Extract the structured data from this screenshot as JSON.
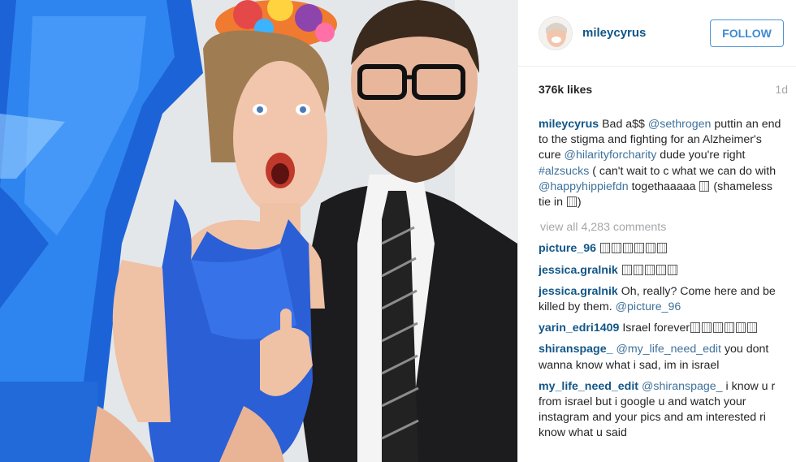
{
  "post": {
    "username": "mileycyrus",
    "follow_label": "FOLLOW",
    "likes": "376k likes",
    "time_ago": "1d"
  },
  "caption": {
    "user": "mileycyrus",
    "t1": "Bad a$$ ",
    "m1": "@sethrogen",
    "t2": " puttin an end to the stigma and fighting for an Alzheimer's cure ",
    "m2": "@hilarityforcharity",
    "t3": " dude you're right ",
    "m3": "#alzsucks",
    "t4": " ( can't wait to c what we can do with ",
    "m4": "@happyhippiefdn",
    "t5": " togethaaaaa ",
    "t6": " (shameless tie in ",
    "t7": ")"
  },
  "view_all": "view all 4,283 comments",
  "comments": [
    {
      "user": "picture_96"
    },
    {
      "user": "jessica.gralnik"
    },
    {
      "user": "jessica.gralnik",
      "text": " Oh, really? Come here and be killed by them. ",
      "mention": "@picture_96"
    },
    {
      "user": "yarin_edri1409",
      "text": " Israel forever"
    },
    {
      "user": "shiranspage_",
      "mention": "@my_life_need_edit",
      "text": " you dont wanna know what i sad, im in israel"
    },
    {
      "user": "my_life_need_edit",
      "mention": "@shiranspage_",
      "text": " i know u r from israel but i google u and watch your instagram and your pics and am interested ri know what u said"
    }
  ],
  "colors": {
    "username_blue": "#125688",
    "mention_blue": "#3f729b",
    "follow_blue": "#3f8ad1",
    "muted_gray": "#a5a7aa",
    "swimsuit_blue": "#2a5fd6"
  }
}
